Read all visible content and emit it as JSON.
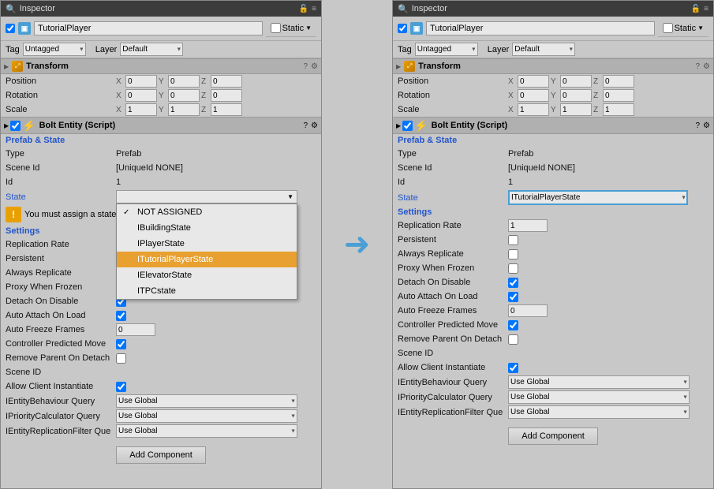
{
  "left_panel": {
    "title": "Inspector",
    "object_name": "TutorialPlayer",
    "static_label": "Static",
    "tag_label": "Tag",
    "tag_value": "Untagged",
    "layer_label": "Layer",
    "layer_value": "Default",
    "transform": {
      "title": "Transform",
      "position_label": "Position",
      "rotation_label": "Rotation",
      "scale_label": "Scale",
      "position": {
        "x": "0",
        "y": "0",
        "z": "0"
      },
      "rotation": {
        "x": "0",
        "y": "0",
        "z": "0"
      },
      "scale": {
        "x": "1",
        "y": "1",
        "z": "1"
      }
    },
    "bolt_entity": {
      "title": "Bolt Entity (Script)",
      "prefab_state_label": "Prefab & State",
      "type_label": "Type",
      "type_value": "Prefab",
      "scene_id_label": "Scene Id",
      "scene_id_value": "[UniqueId NONE]",
      "id_label": "Id",
      "id_value": "1",
      "state_label": "State",
      "state_value": "",
      "warning_text": "You must assign a state",
      "dropdown_items": [
        {
          "label": "NOT ASSIGNED",
          "checked": true
        },
        {
          "label": "IBuildingState",
          "checked": false
        },
        {
          "label": "IPlayerState",
          "checked": false
        },
        {
          "label": "ITutorialPlayerState",
          "checked": false,
          "selected": true
        },
        {
          "label": "IElevatorState",
          "checked": false
        },
        {
          "label": "ITPCstate",
          "checked": false
        }
      ],
      "settings_label": "Settings",
      "replication_rate_label": "Replication Rate",
      "replication_rate_value": "",
      "persistent_label": "Persistent",
      "always_replicate_label": "Always Replicate",
      "proxy_when_frozen_label": "Proxy When Frozen",
      "detach_on_disable_label": "Detach On Disable",
      "detach_checked": true,
      "auto_attach_label": "Auto Attach On Load",
      "auto_attach_checked": true,
      "auto_freeze_label": "Auto Freeze Frames",
      "auto_freeze_value": "0",
      "controller_predicted_label": "Controller Predicted Move",
      "controller_checked": true,
      "remove_parent_label": "Remove Parent On Detach",
      "remove_parent_checked": false,
      "scene_id2_label": "Scene ID",
      "allow_client_label": "Allow Client Instantiate",
      "allow_client_checked": true,
      "entity_behaviour_label": "IEntityBehaviour Query",
      "entity_behaviour_value": "Use Global",
      "priority_calc_label": "IPriorityCalculator Query",
      "priority_calc_value": "Use Global",
      "entity_filter_label": "IEntityReplicationFilter Que",
      "entity_filter_value": "Use Global",
      "add_component_label": "Add Component"
    }
  },
  "right_panel": {
    "title": "Inspector",
    "object_name": "TutorialPlayer",
    "static_label": "Static",
    "tag_label": "Tag",
    "tag_value": "Untagged",
    "layer_label": "Layer",
    "layer_value": "Default",
    "transform": {
      "title": "Transform",
      "position_label": "Position",
      "rotation_label": "Rotation",
      "scale_label": "Scale",
      "position": {
        "x": "0",
        "y": "0",
        "z": "0"
      },
      "rotation": {
        "x": "0",
        "y": "0",
        "z": "0"
      },
      "scale": {
        "x": "1",
        "y": "1",
        "z": "1"
      }
    },
    "bolt_entity": {
      "title": "Bolt Entity (Script)",
      "prefab_state_label": "Prefab & State",
      "type_label": "Type",
      "type_value": "Prefab",
      "scene_id_label": "Scene Id",
      "scene_id_value": "[UniqueId NONE]",
      "id_label": "Id",
      "id_value": "1",
      "state_label": "State",
      "state_value": "ITutorialPlayerState",
      "settings_label": "Settings",
      "replication_rate_label": "Replication Rate",
      "replication_rate_value": "1",
      "persistent_label": "Persistent",
      "always_replicate_label": "Always Replicate",
      "proxy_when_frozen_label": "Proxy When Frozen",
      "detach_on_disable_label": "Detach On Disable",
      "detach_checked": true,
      "auto_attach_label": "Auto Attach On Load",
      "auto_attach_checked": true,
      "auto_freeze_label": "Auto Freeze Frames",
      "auto_freeze_value": "0",
      "controller_predicted_label": "Controller Predicted Move",
      "controller_checked": true,
      "remove_parent_label": "Remove Parent On Detach",
      "remove_parent_checked": false,
      "scene_id2_label": "Scene ID",
      "allow_client_label": "Allow Client Instantiate",
      "allow_client_checked": true,
      "entity_behaviour_label": "IEntityBehaviour Query",
      "entity_behaviour_value": "Use Global",
      "priority_calc_label": "IPriorityCalculator Query",
      "priority_calc_value": "Use Global",
      "entity_filter_label": "IEntityReplicationFilter Que",
      "entity_filter_value": "Use Global",
      "add_component_label": "Add Component"
    }
  },
  "arrow": "→"
}
